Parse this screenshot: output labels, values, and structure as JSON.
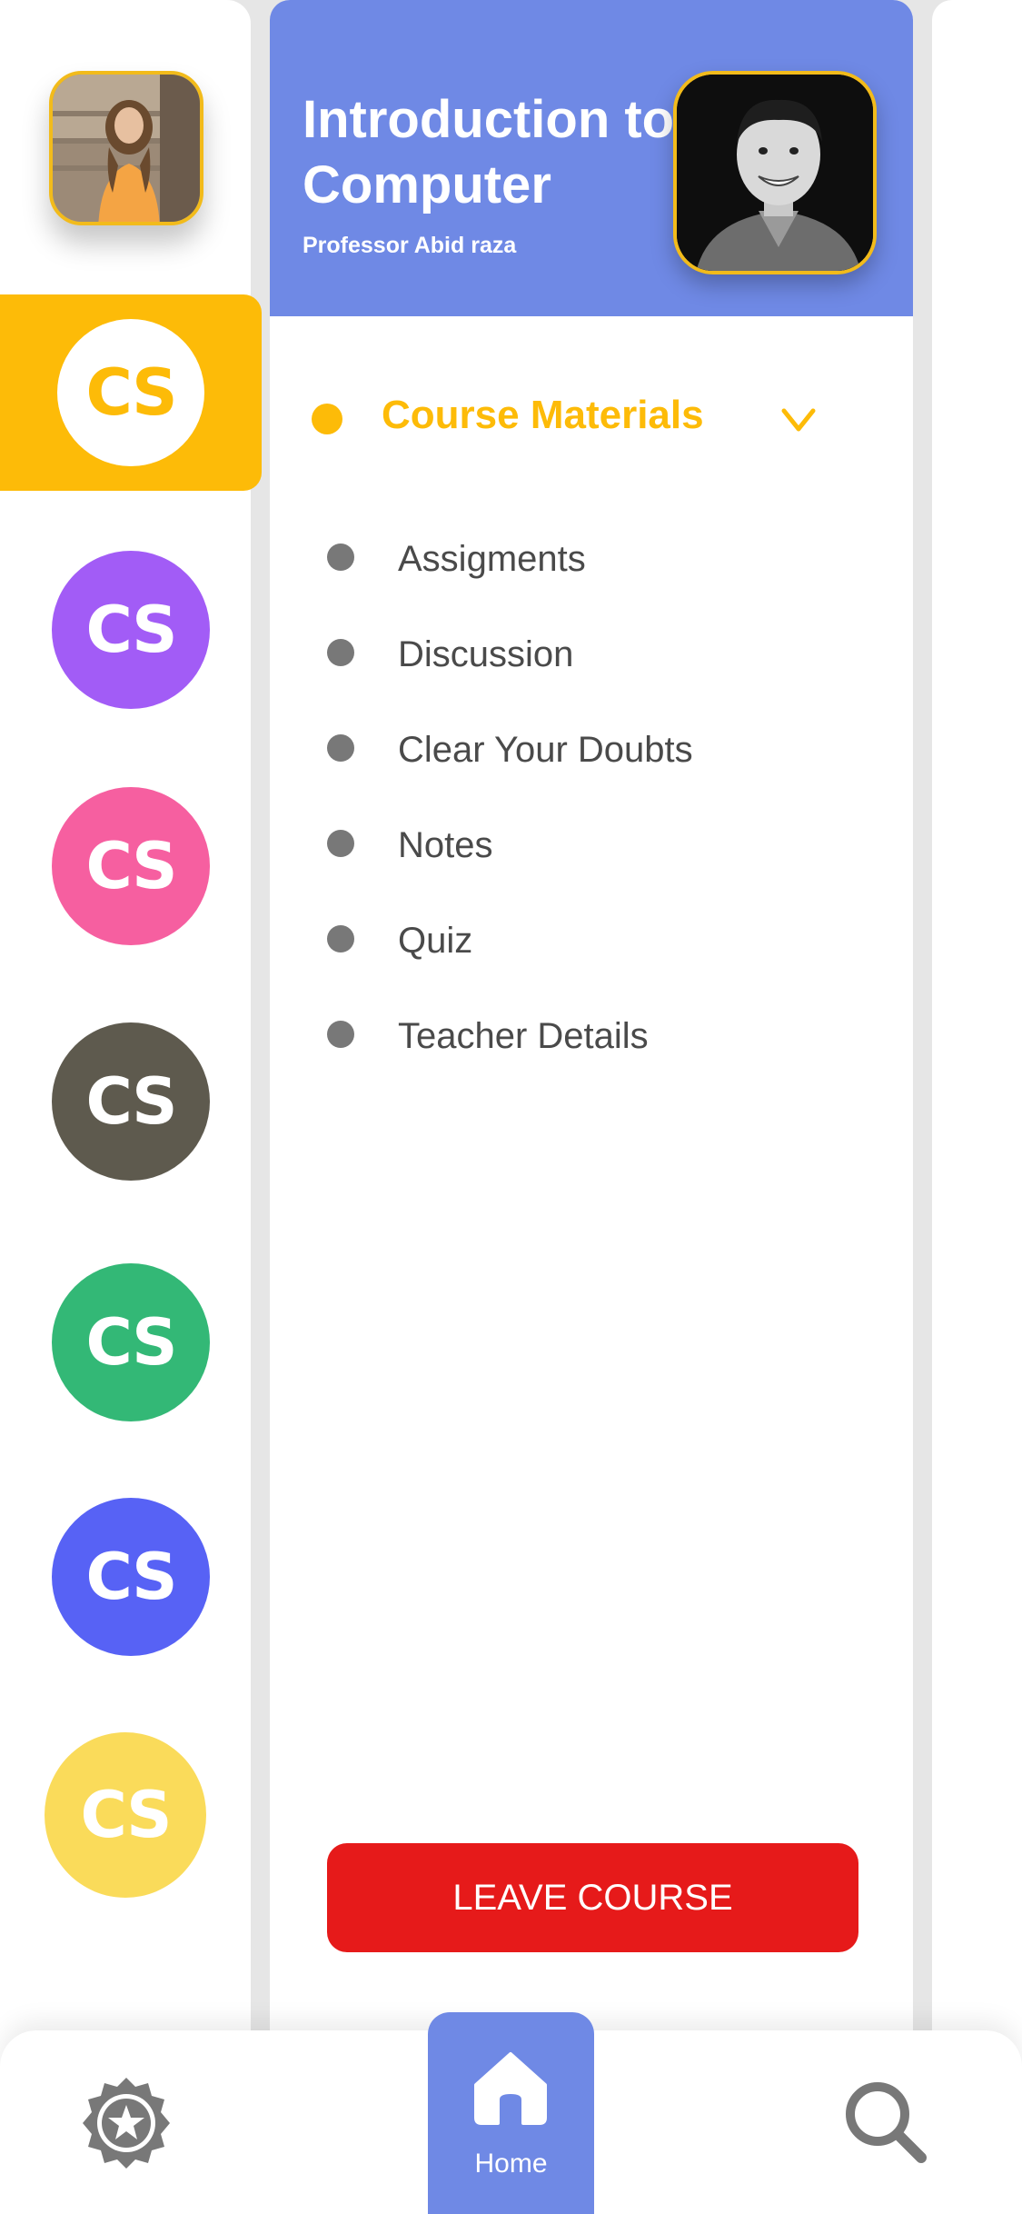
{
  "colors": {
    "primary": "#6f89e5",
    "accent": "#fdbb08",
    "danger": "#e61a1a",
    "text_muted": "#4a4a4a",
    "bullet": "#787878"
  },
  "sidebar": {
    "courses": [
      {
        "label": "CS",
        "color": "#ffffff",
        "active": true
      },
      {
        "label": "CS",
        "color": "#a25cf6"
      },
      {
        "label": "CS",
        "color": "#f65fa0"
      },
      {
        "label": "CS",
        "color": "#5e5a4e"
      },
      {
        "label": "CS",
        "color": "#33b876"
      },
      {
        "label": "CS",
        "color": "#5762f5"
      },
      {
        "label": "CS",
        "color": "#fadb5a"
      }
    ]
  },
  "course": {
    "title": "Introduction to Computer",
    "professor": "Professor Abid raza"
  },
  "materials": {
    "title": "Course Materials",
    "items": [
      "Assigments",
      "Discussion",
      "Clear Your Doubts",
      "Notes",
      "Quiz",
      "Teacher Details"
    ]
  },
  "actions": {
    "leave_label": "LEAVE COURSE"
  },
  "bottom_nav": {
    "home_label": "Home",
    "icons": [
      "badge-icon",
      "home-icon",
      "search-icon"
    ]
  }
}
